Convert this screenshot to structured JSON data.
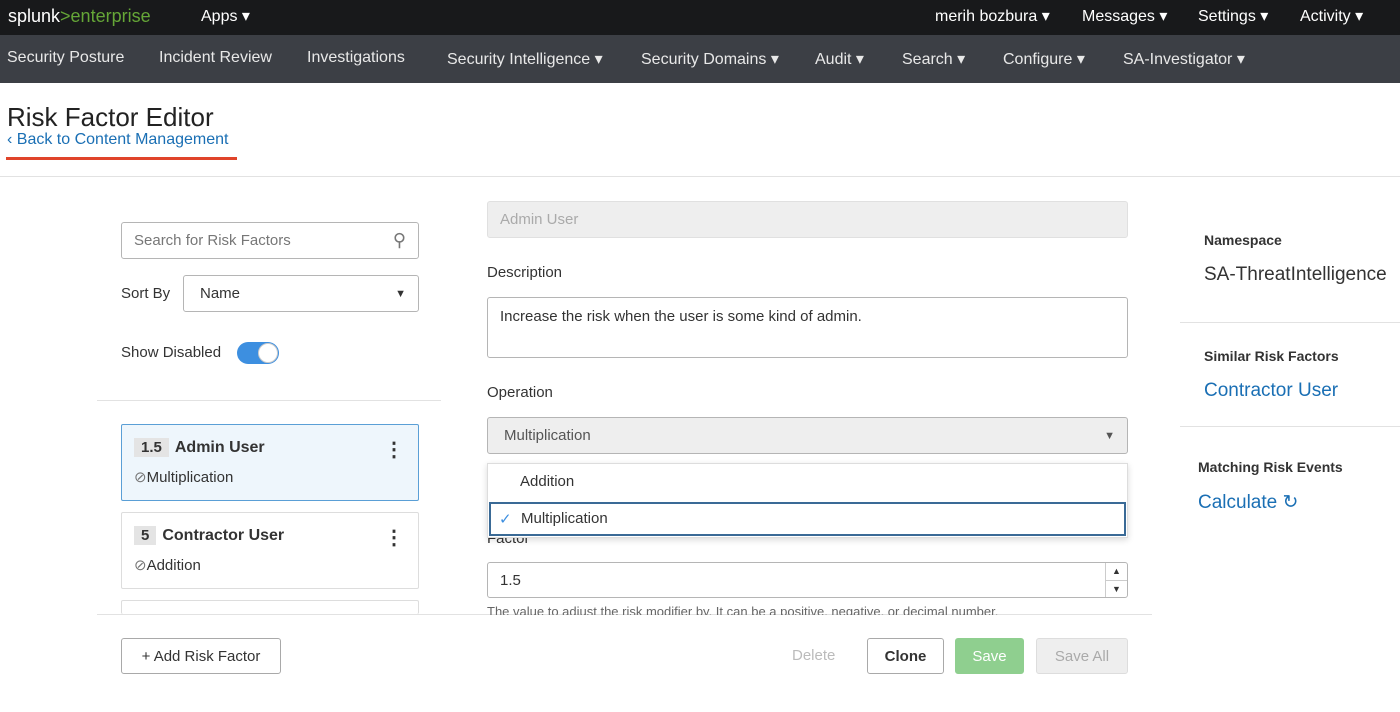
{
  "topbar": {
    "logo_a": "splunk",
    "logo_b": ">enterprise",
    "apps": "Apps ▾",
    "user": "merih bozbura ▾",
    "messages": "Messages ▾",
    "settings": "Settings ▾",
    "activity": "Activity ▾"
  },
  "nav": [
    "Security Posture",
    "Incident Review",
    "Investigations",
    "Security Intelligence ▾",
    "Security Domains ▾",
    "Audit ▾",
    "Search ▾",
    "Configure ▾",
    "SA-Investigator ▾"
  ],
  "page": {
    "title": "Risk Factor Editor",
    "back": "Back to Content Management"
  },
  "sidebar": {
    "search_placeholder": "Search for Risk Factors",
    "sort_label": "Sort By",
    "sort_value": "Name",
    "show_disabled": "Show Disabled",
    "show_disabled_on": true,
    "items": [
      {
        "factor": "1.5",
        "name": "Admin User",
        "op": "Multiplication"
      },
      {
        "factor": "5",
        "name": "Contractor User",
        "op": "Addition"
      }
    ],
    "add": "+ Add Risk Factor"
  },
  "form": {
    "name_placeholder": "Admin User",
    "description_label": "Description",
    "description": "Increase the risk when the user is some kind of admin.",
    "operation_label": "Operation",
    "operation": "Multiplication",
    "options": [
      "Addition",
      "Multiplication"
    ],
    "factor_label": "Factor",
    "factor": "1.5",
    "factor_help": "The value to adjust the risk modifier by. It can be a positive, negative, or decimal number."
  },
  "buttons": {
    "delete": "Delete",
    "clone": "Clone",
    "save": "Save",
    "save_all": "Save All"
  },
  "right": {
    "namespace_label": "Namespace",
    "namespace": "SA-ThreatIntelligence",
    "similar_label": "Similar Risk Factors",
    "similar": "Contractor User",
    "matching_label": "Matching Risk Events",
    "calculate": "Calculate"
  },
  "colors": {
    "link": "#1a6fb4",
    "save": "#8fcf8f",
    "toggle": "#3d8fe0"
  }
}
